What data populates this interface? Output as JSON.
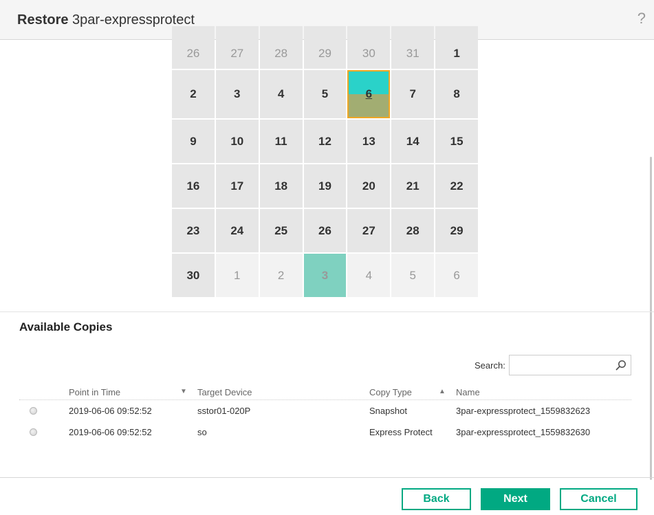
{
  "header": {
    "title_bold": "Restore",
    "title_name": "3par-expressprotect",
    "help_icon": "?"
  },
  "calendar": {
    "rows": [
      [
        {
          "day": "26",
          "state": "out"
        },
        {
          "day": "27",
          "state": "out"
        },
        {
          "day": "28",
          "state": "out"
        },
        {
          "day": "29",
          "state": "out"
        },
        {
          "day": "30",
          "state": "out"
        },
        {
          "day": "31",
          "state": "out"
        },
        {
          "day": "1",
          "state": "normal"
        }
      ],
      [
        {
          "day": "2",
          "state": "normal"
        },
        {
          "day": "3",
          "state": "normal"
        },
        {
          "day": "4",
          "state": "normal"
        },
        {
          "day": "5",
          "state": "normal"
        },
        {
          "day": "6",
          "state": "selected"
        },
        {
          "day": "7",
          "state": "normal"
        },
        {
          "day": "8",
          "state": "normal"
        }
      ],
      [
        {
          "day": "9",
          "state": "normal"
        },
        {
          "day": "10",
          "state": "normal"
        },
        {
          "day": "11",
          "state": "normal"
        },
        {
          "day": "12",
          "state": "normal"
        },
        {
          "day": "13",
          "state": "normal"
        },
        {
          "day": "14",
          "state": "normal"
        },
        {
          "day": "15",
          "state": "normal"
        }
      ],
      [
        {
          "day": "16",
          "state": "normal"
        },
        {
          "day": "17",
          "state": "normal"
        },
        {
          "day": "18",
          "state": "normal"
        },
        {
          "day": "19",
          "state": "normal"
        },
        {
          "day": "20",
          "state": "normal"
        },
        {
          "day": "21",
          "state": "normal"
        },
        {
          "day": "22",
          "state": "normal"
        }
      ],
      [
        {
          "day": "23",
          "state": "normal"
        },
        {
          "day": "24",
          "state": "normal"
        },
        {
          "day": "25",
          "state": "normal"
        },
        {
          "day": "26",
          "state": "normal"
        },
        {
          "day": "27",
          "state": "normal"
        },
        {
          "day": "28",
          "state": "normal"
        },
        {
          "day": "29",
          "state": "normal"
        }
      ],
      [
        {
          "day": "30",
          "state": "normal"
        },
        {
          "day": "1",
          "state": "out"
        },
        {
          "day": "2",
          "state": "out"
        },
        {
          "day": "3",
          "state": "today"
        },
        {
          "day": "4",
          "state": "out"
        },
        {
          "day": "5",
          "state": "out"
        },
        {
          "day": "6",
          "state": "out"
        }
      ]
    ],
    "colors": {
      "selected_top": "#2ad2c9",
      "selected_bottom": "#a2ad72",
      "selected_border": "#f0a724",
      "today": "#7fd1c0"
    }
  },
  "copies": {
    "title": "Available Copies",
    "search": {
      "label": "Search:",
      "placeholder": "",
      "value": ""
    },
    "columns": {
      "point_in_time": "Point in Time",
      "target_device": "Target Device",
      "copy_type": "Copy Type",
      "name": "Name"
    },
    "rows": [
      {
        "point_in_time": "2019-06-06 09:52:52",
        "target_device": "sstor01-020P",
        "copy_type": "Snapshot",
        "name": "3par-expressprotect_1559832623"
      },
      {
        "point_in_time": "2019-06-06 09:52:52",
        "target_device": "so",
        "copy_type": "Express Protect",
        "name": "3par-expressprotect_1559832630"
      }
    ]
  },
  "footer": {
    "back": "Back",
    "next": "Next",
    "cancel": "Cancel",
    "accent": "#01a982"
  }
}
